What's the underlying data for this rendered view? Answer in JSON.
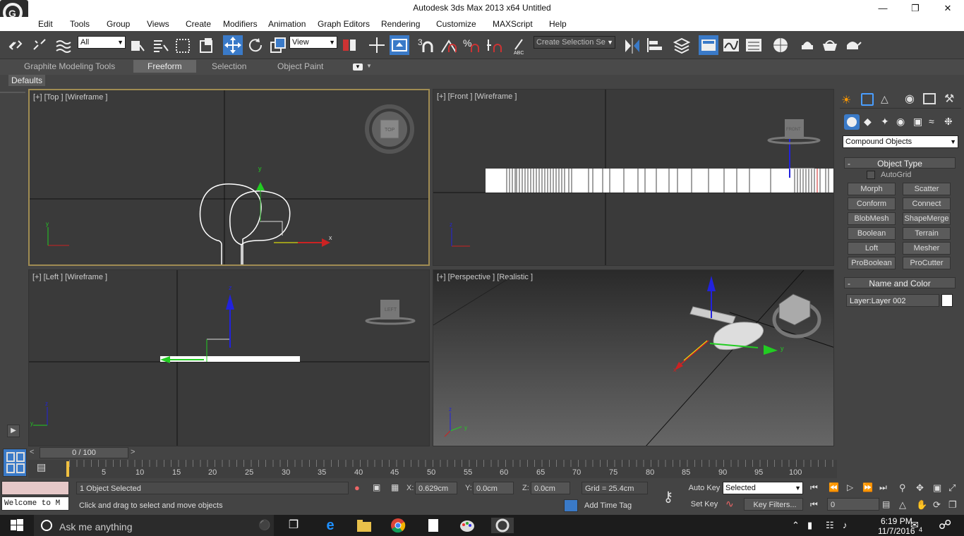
{
  "window": {
    "title": "Autodesk 3ds Max  2013 x64      Untitled"
  },
  "menu": [
    "Edit",
    "Tools",
    "Group",
    "Views",
    "Create",
    "Modifiers",
    "Animation",
    "Graph Editors",
    "Rendering",
    "Customize",
    "MAXScript",
    "Help"
  ],
  "toolbar": {
    "filter_select": "All",
    "ref_coord": "View",
    "named_selection_placeholder": "Create Selection Se"
  },
  "ribbon": {
    "tabs": [
      "Graphite Modeling Tools",
      "Freeform",
      "Selection",
      "Object Paint"
    ],
    "active": "Freeform",
    "defaults_label": "Defaults"
  },
  "viewports": {
    "top": {
      "label": "[+] [Top ] [Wireframe ]",
      "cube": "TOP"
    },
    "front": {
      "label": "[+] [Front ] [Wireframe ]",
      "cube": "FRONT"
    },
    "left": {
      "label": "[+] [Left ] [Wireframe ]",
      "cube": "LEFT"
    },
    "perspective": {
      "label": "[+] [Perspective ] [Realistic ]"
    }
  },
  "command_panel": {
    "category": "Compound Objects",
    "object_type_title": "Object Type",
    "autogrid_label": "AutoGrid",
    "buttons": [
      "Morph",
      "Scatter",
      "Conform",
      "Connect",
      "BlobMesh",
      "ShapeMerge",
      "Boolean",
      "Terrain",
      "Loft",
      "Mesher",
      "ProBoolean",
      "ProCutter"
    ],
    "name_color_title": "Name and Color",
    "name_value": "Layer:Layer 002",
    "swatch_color": "#ffffff"
  },
  "timeline": {
    "frame": "0 / 100",
    "ticks": [
      "5",
      "10",
      "15",
      "20",
      "25",
      "30",
      "35",
      "40",
      "45",
      "50",
      "55",
      "60",
      "65",
      "70",
      "75",
      "80",
      "85",
      "90",
      "95",
      "100"
    ]
  },
  "status": {
    "selection": "1 Object Selected",
    "prompt": "Click and drag to select and move objects",
    "maxscript": "Welcome to M",
    "x": "0.629cm",
    "y": "0.0cm",
    "z": "0.0cm",
    "x_label": "X:",
    "y_label": "Y:",
    "z_label": "Z:",
    "grid": "Grid = 25.4cm",
    "add_time_tag": "Add Time Tag",
    "auto_key": "Auto Key",
    "set_key": "Set Key",
    "key_mode": "Selected",
    "key_filters": "Key Filters...",
    "frame_field": "0"
  },
  "taskbar": {
    "search": "Ask me anything",
    "time": "6:19 PM",
    "date": "11/7/2016",
    "notif_count": "4"
  }
}
